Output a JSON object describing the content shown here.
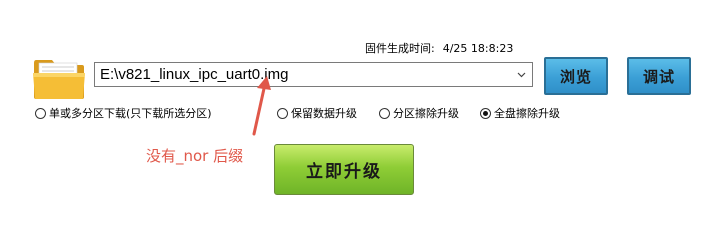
{
  "firmware": {
    "time_label": "固件生成时间:",
    "time_value": "4/25 18:8:23"
  },
  "image_path": {
    "value": "E:\\v821_linux_ipc_uart0.img"
  },
  "buttons": {
    "browse": "浏览",
    "debug": "调试",
    "upgrade": "立即升级"
  },
  "options": [
    {
      "label": "单或多分区下载(只下载所选分区)",
      "selected": false
    },
    {
      "label": "保留数据升级",
      "selected": false
    },
    {
      "label": "分区擦除升级",
      "selected": false
    },
    {
      "label": "全盘擦除升级",
      "selected": true
    }
  ],
  "annotation": {
    "text": "没有_nor 后缀",
    "color": "#e0584a"
  },
  "icons": {
    "folder": "folder-icon",
    "dropdown": "chevron-down-icon",
    "annotation_arrow": "arrow-up-icon"
  }
}
